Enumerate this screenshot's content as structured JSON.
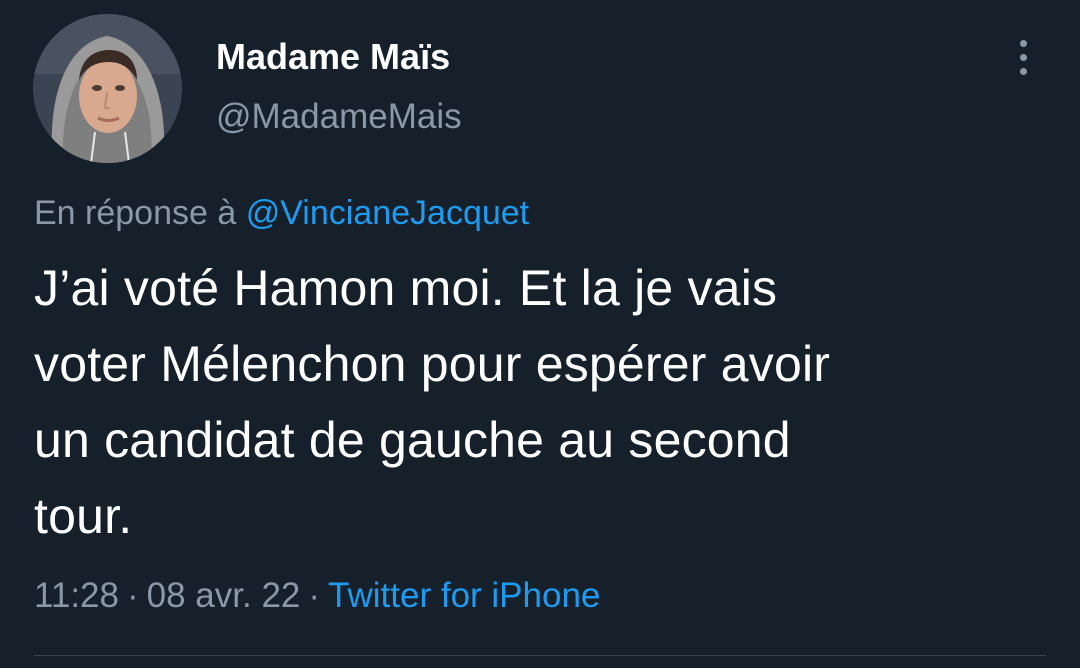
{
  "tweet": {
    "author": {
      "display_name": "Madame Maïs",
      "handle": "@MadameMais"
    },
    "reply": {
      "prefix": "En réponse à",
      "mention": "@VincianeJacquet"
    },
    "text_lines": [
      "J’ai voté Hamon moi. Et la je vais",
      "voter Mélenchon pour espérer avoir",
      "un candidat de gauche au second",
      "tour."
    ],
    "meta": {
      "time": "11:28",
      "separator": "·",
      "date": "08 avr. 22",
      "source": "Twitter for iPhone"
    },
    "icons": {
      "more": "more-vertical-icon"
    },
    "colors": {
      "background": "#15202b",
      "primary_text": "#ffffff",
      "secondary_text": "#8b98a5",
      "link": "#1d9bf0",
      "divider": "#38444d"
    }
  }
}
